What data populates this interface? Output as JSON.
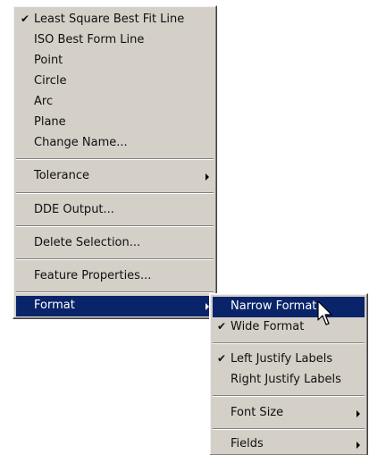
{
  "main_menu": {
    "items": [
      {
        "label": "Least Square Best Fit Line",
        "checked": true
      },
      {
        "label": "ISO Best Form Line"
      },
      {
        "label": "Point"
      },
      {
        "label": "Circle"
      },
      {
        "label": "Arc"
      },
      {
        "label": "Plane"
      },
      {
        "label": "Change Name..."
      },
      {
        "label": "Tolerance",
        "submenu": true
      },
      {
        "label": "DDE Output..."
      },
      {
        "label": "Delete Selection..."
      },
      {
        "label": "Feature Properties..."
      },
      {
        "label": "Format",
        "submenu": true,
        "highlighted": true
      }
    ]
  },
  "format_submenu": {
    "items": [
      {
        "label": "Narrow Format",
        "highlighted": true
      },
      {
        "label": "Wide Format",
        "checked": true
      },
      {
        "label": "Left Justify Labels",
        "checked": true
      },
      {
        "label": "Right Justify Labels"
      },
      {
        "label": "Font Size",
        "submenu": true
      },
      {
        "label": "Fields",
        "submenu": true
      }
    ]
  },
  "check_glyph": "✔",
  "colors": {
    "menu_bg": "#d4d0c8",
    "highlight": "#0a246a",
    "highlight_text": "#ffffff"
  }
}
